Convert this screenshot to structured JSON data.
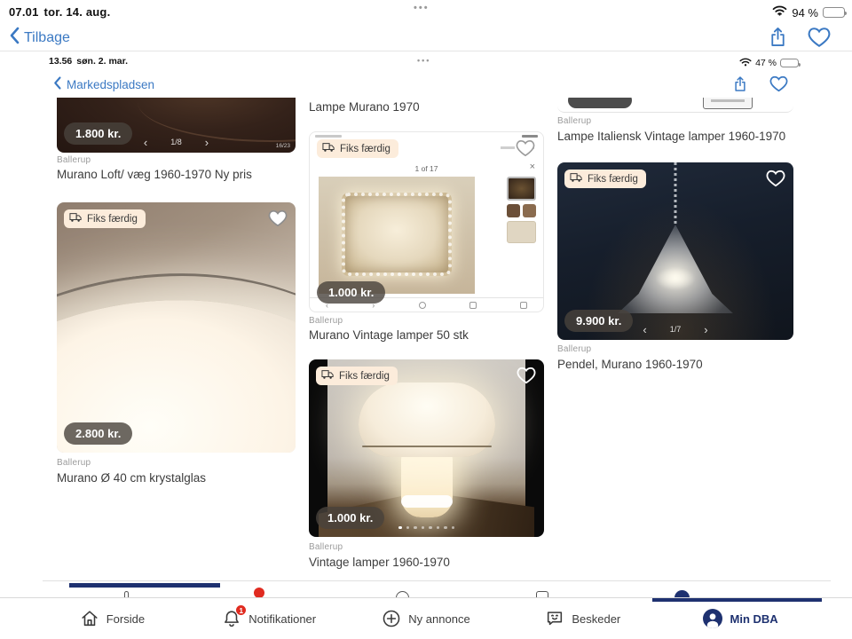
{
  "icons": {
    "dots": "•••",
    "chevron_left": "‹",
    "chevron_right": "›",
    "close": "×"
  },
  "status_outer": {
    "time": "07.01",
    "date": "tor. 14. aug.",
    "battery_percent": "94 %"
  },
  "nav_outer": {
    "back_label": "Tilbage"
  },
  "status_inner": {
    "time": "13.56",
    "date": "søn. 2. mar.",
    "battery_percent": "47 %"
  },
  "nav_inner": {
    "back_label": "Markedspladsen"
  },
  "badge_fiks": "Fiks færdig",
  "listings": {
    "col1_item1": {
      "price": "1.800 kr.",
      "carousel": "1/8",
      "corner_counter": "16/23",
      "location": "Ballerup",
      "title": "Murano Loft/ væg 1960-1970 Ny pris"
    },
    "col1_item2": {
      "price": "2.800 kr.",
      "location": "Ballerup",
      "title": "Murano Ø 40 cm krystalglas"
    },
    "col2_item0": {
      "title": "Lampe Murano 1970"
    },
    "col2_item1": {
      "price": "1.000 kr.",
      "gallery_counter": "1 of 17",
      "location": "Ballerup",
      "title": "Murano Vintage lamper 50 stk"
    },
    "col2_item2": {
      "price": "1.000 kr.",
      "location": "Ballerup",
      "title": "Vintage lamper 1960-1970"
    },
    "col3_item0": {
      "location": "Ballerup",
      "title": "Lampe Italiensk Vintage lamper 1960-1970"
    },
    "col3_item1": {
      "price": "9.900 kr.",
      "carousel": "1/7",
      "location": "Ballerup",
      "title": "Pendel, Murano 1960-1970"
    }
  },
  "tabbar": {
    "forside": "Forside",
    "notifikationer": "Notifikationer",
    "notification_badge": "1",
    "ny_annonce": "Ny annonce",
    "beskeder": "Beskeder",
    "min_dba": "Min DBA"
  },
  "colors": {
    "accent_blue": "#3b79c3",
    "navy": "#1e3170",
    "badge_red": "#e02b20",
    "fiks_badge_bg": "#fcecdb"
  }
}
